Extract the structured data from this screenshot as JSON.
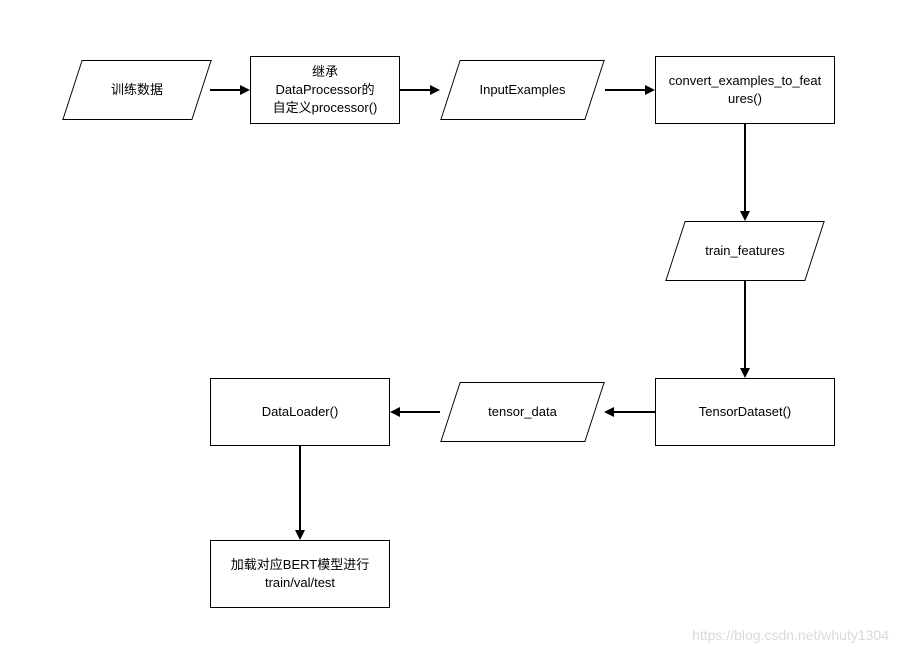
{
  "chart_data": {
    "type": "flowchart",
    "nodes": [
      {
        "id": "n1",
        "shape": "parallelogram",
        "label": "训练数据"
      },
      {
        "id": "n2",
        "shape": "rectangle",
        "label": "继承\nDataProcessor的\n自定义processor()"
      },
      {
        "id": "n3",
        "shape": "parallelogram",
        "label": "InputExamples"
      },
      {
        "id": "n4",
        "shape": "rectangle",
        "label": "convert_examples_to_features()"
      },
      {
        "id": "n5",
        "shape": "parallelogram",
        "label": "train_features"
      },
      {
        "id": "n6",
        "shape": "rectangle",
        "label": "TensorDataset()"
      },
      {
        "id": "n7",
        "shape": "parallelogram",
        "label": "tensor_data"
      },
      {
        "id": "n8",
        "shape": "rectangle",
        "label": "DataLoader()"
      },
      {
        "id": "n9",
        "shape": "rectangle",
        "label": "加载对应BERT模型进行\ntrain/val/test"
      }
    ],
    "edges": [
      {
        "from": "n1",
        "to": "n2"
      },
      {
        "from": "n2",
        "to": "n3"
      },
      {
        "from": "n3",
        "to": "n4"
      },
      {
        "from": "n4",
        "to": "n5"
      },
      {
        "from": "n5",
        "to": "n6"
      },
      {
        "from": "n6",
        "to": "n7"
      },
      {
        "from": "n7",
        "to": "n8"
      },
      {
        "from": "n8",
        "to": "n9"
      }
    ]
  },
  "nodes": {
    "n1": "训练数据",
    "n2_l1": "继承",
    "n2_l2": "DataProcessor的",
    "n2_l3": "自定义processor()",
    "n3": "InputExamples",
    "n4_l1": "convert_examples_to_feat",
    "n4_l2": "ures()",
    "n5": "train_features",
    "n6": "TensorDataset()",
    "n7": "tensor_data",
    "n8": "DataLoader()",
    "n9_l1": "加载对应BERT模型进行",
    "n9_l2": "train/val/test"
  },
  "watermark": "https://blog.csdn.net/whuty1304"
}
